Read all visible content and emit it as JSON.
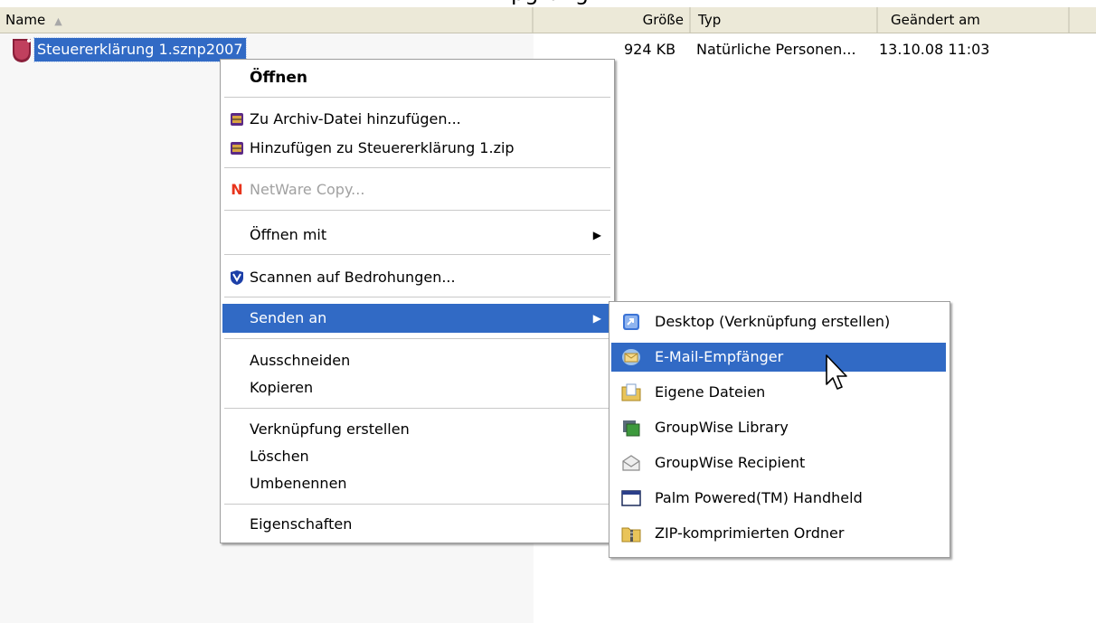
{
  "caption_peek": "pgrung",
  "columns": {
    "name": "Name",
    "size": "Größe",
    "type": "Typ",
    "modified": "Geändert am"
  },
  "file": {
    "name": "Steuererklärung 1.sznp2007",
    "size": "924 KB",
    "type": "Natürliche Personen...",
    "modified": "13.10.08 11:03"
  },
  "context_menu": {
    "open": "Öffnen",
    "add_archive": "Zu Archiv-Datei hinzufügen...",
    "add_zip": "Hinzufügen zu Steuererklärung 1.zip",
    "netware_letter": "N",
    "netware_copy": "NetWare Copy...",
    "open_with": "Öffnen mit",
    "scan": "Scannen auf Bedrohungen...",
    "send_to": "Senden an",
    "cut": "Ausschneiden",
    "copy": "Kopieren",
    "create_shortcut": "Verknüpfung erstellen",
    "delete": "Löschen",
    "rename": "Umbenennen",
    "properties": "Eigenschaften"
  },
  "send_to_menu": {
    "items": [
      {
        "label": "Desktop (Verknüpfung erstellen)",
        "icon": "desktop-shortcut-icon"
      },
      {
        "label": "E-Mail-Empfänger",
        "icon": "mail-recipient-icon"
      },
      {
        "label": "Eigene Dateien",
        "icon": "my-documents-icon"
      },
      {
        "label": "GroupWise Library",
        "icon": "groupwise-library-icon"
      },
      {
        "label": "GroupWise Recipient",
        "icon": "groupwise-recipient-icon"
      },
      {
        "label": "Palm Powered(TM) Handheld",
        "icon": "palm-handheld-icon"
      },
      {
        "label": "ZIP-komprimierten Ordner",
        "icon": "zip-folder-icon"
      }
    ],
    "highlighted_index": 1
  },
  "colors": {
    "selection": "#316ac5",
    "header_bg": "#ece9d8",
    "netware_red": "#e8341c"
  }
}
